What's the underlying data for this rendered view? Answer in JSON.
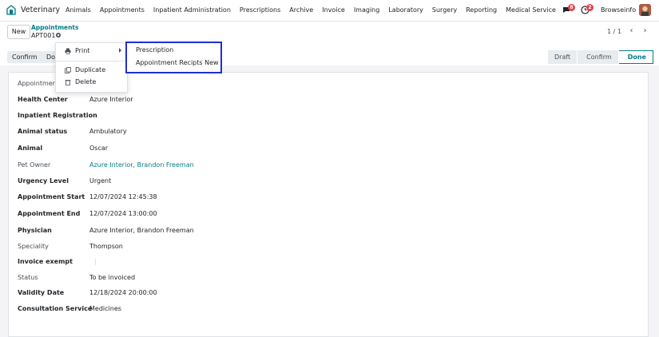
{
  "app": {
    "name": "Veterinary"
  },
  "menu": [
    "Animals",
    "Appointments",
    "Inpatient Administration",
    "Prescriptions",
    "Archive",
    "Invoice",
    "Imaging",
    "Laboratory",
    "Surgery",
    "Reporting",
    "Medical Service"
  ],
  "nav": {
    "chat_count": "8",
    "activity_count": "2",
    "user": "Browseinfo"
  },
  "control": {
    "new_label": "New",
    "breadcrumb_parent": "Appointments",
    "record": "APT001",
    "pager": "1 / 1"
  },
  "statusbar": {
    "confirm_label": "Confirm",
    "second_label": "Do",
    "stages": [
      "Draft",
      "Confirm",
      "Done"
    ]
  },
  "dropdown": {
    "print": "Print",
    "duplicate": "Duplicate",
    "delete": "Delete"
  },
  "submenu": {
    "items": [
      "Prescription",
      "Appointment Recipts New"
    ]
  },
  "form": {
    "fields": [
      {
        "label": "Appointment",
        "value": ""
      },
      {
        "label": "Health Center",
        "value": "Azure Interior"
      },
      {
        "label": "Inpatient Registration",
        "value": ""
      },
      {
        "label": "Animal status",
        "value": "Ambulatory"
      },
      {
        "label": "Animal",
        "value": "Oscar"
      },
      {
        "label": "Pet Owner",
        "value": "Azure Interior, Brandon Freeman"
      },
      {
        "label": "Urgency Level",
        "value": "Urgent"
      },
      {
        "label": "Appointment Start",
        "value": "12/07/2024 12:45:38"
      },
      {
        "label": "Appointment End",
        "value": "12/07/2024 13:00:00"
      },
      {
        "label": "Physician",
        "value": "Azure Interior, Brandon Freeman"
      },
      {
        "label": "Speciality",
        "value": "Thompson"
      },
      {
        "label": "Invoice exempt",
        "value": ""
      },
      {
        "label": "Status",
        "value": "To be invoiced"
      },
      {
        "label": "Validity Date",
        "value": "12/18/2024 20:00:00"
      },
      {
        "label": "Consultation Service",
        "value": "Medicines"
      }
    ]
  },
  "colors": {
    "accent": "#017e84",
    "highlight_border": "#1f2fd4",
    "badge": "#e4434a"
  }
}
